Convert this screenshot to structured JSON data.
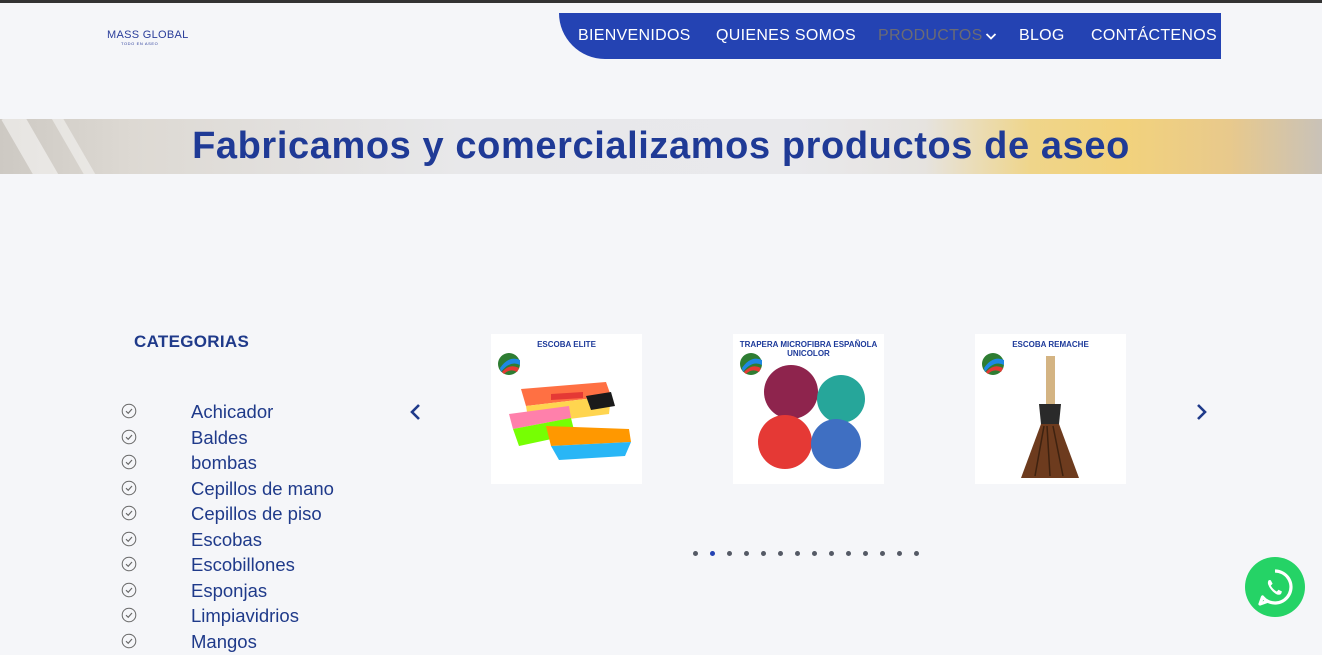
{
  "logo": {
    "brand": "MASS GLOBAL",
    "tagline": "TODO EN ASEO"
  },
  "nav": {
    "items": [
      {
        "label": "BIENVENIDOS"
      },
      {
        "label": "QUIENES SOMOS"
      },
      {
        "label": "PRODUCTOS",
        "active": true
      },
      {
        "label": "BLOG"
      },
      {
        "label": "CONTÁCTENOS"
      }
    ]
  },
  "banner": {
    "title": "Fabricamos y comercializamos productos de aseo"
  },
  "categories": {
    "title": "CATEGORIAS",
    "items": [
      "Achicador",
      "Baldes",
      "bombas",
      "Cepillos de mano",
      "Cepillos de piso",
      "Escobas",
      "Escobillones",
      "Esponjas",
      "Limpiavidrios",
      "Mangos"
    ]
  },
  "carousel": {
    "products": [
      {
        "title": "ESCOBA ELITE"
      },
      {
        "title": "TRAPERA MICROFIBRA ESPAÑOLA UNICOLOR"
      },
      {
        "title": "ESCOBA  REMACHE"
      }
    ],
    "dot_count": 14,
    "active_dot": 1
  },
  "icons": {
    "prev": "chevron-left-icon",
    "next": "chevron-right-icon",
    "category": "check-circle-icon",
    "whatsapp": "whatsapp-icon"
  },
  "colors": {
    "brand_blue": "#2443b3",
    "text_blue": "#1f3a8a",
    "whatsapp_green": "#25d366",
    "background": "#f5f6f9"
  }
}
